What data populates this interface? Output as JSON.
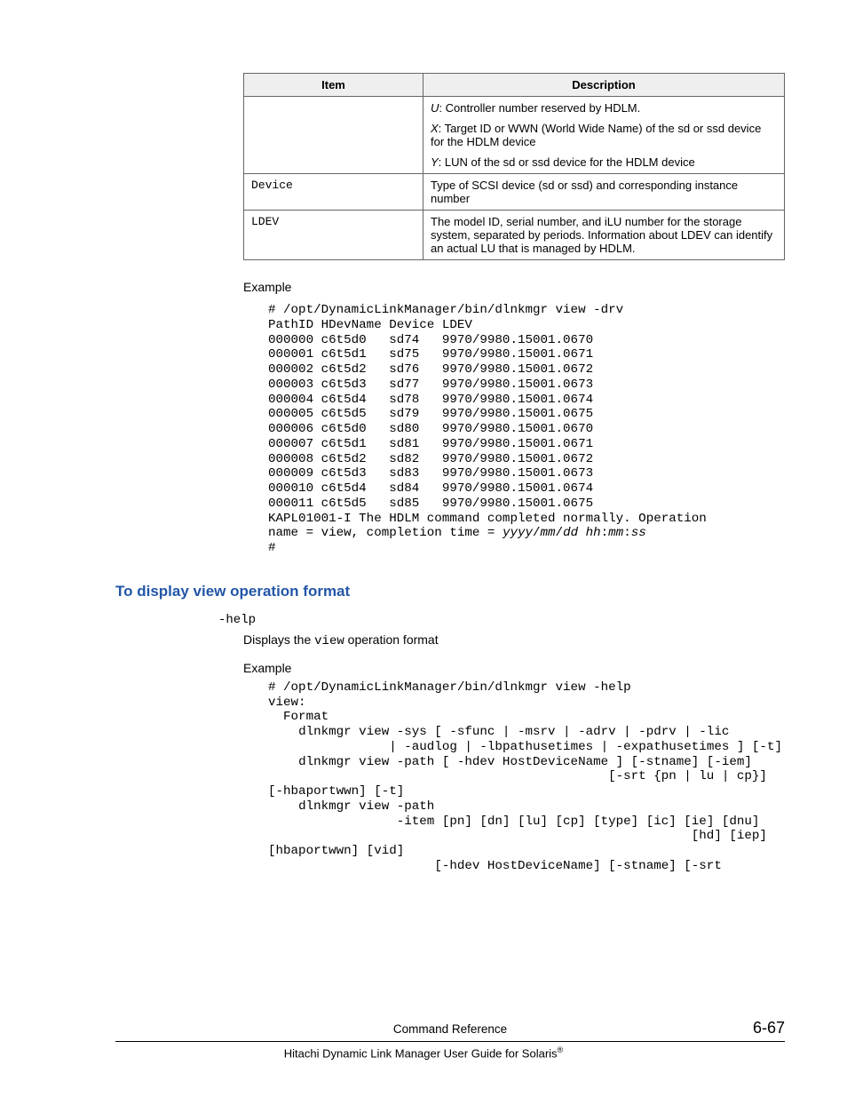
{
  "table": {
    "header": {
      "col1": "Item",
      "col2": "Description"
    },
    "rows": [
      {
        "item": "",
        "desc_parts": {
          "u": "U",
          "u_text": ": Controller number reserved by HDLM.",
          "x": "X",
          "x_text": ": Target ID or WWN (World Wide Name) of the sd or ssd device for the HDLM device",
          "y": "Y",
          "y_text": ": LUN of the sd or ssd device for the HDLM device"
        }
      },
      {
        "item": "Device",
        "desc": "Type of SCSI device (sd or ssd) and corresponding instance number"
      },
      {
        "item": "LDEV",
        "desc": "The model ID, serial number, and iLU number for the storage system, separated by periods. Information about LDEV can identify an actual LU that is managed by HDLM."
      }
    ]
  },
  "example1": {
    "label": "Example",
    "text": "# /opt/DynamicLinkManager/bin/dlnkmgr view -drv\nPathID HDevName Device LDEV\n000000 c6t5d0   sd74   9970/9980.15001.0670\n000001 c6t5d1   sd75   9970/9980.15001.0671\n000002 c6t5d2   sd76   9970/9980.15001.0672\n000003 c6t5d3   sd77   9970/9980.15001.0673\n000004 c6t5d4   sd78   9970/9980.15001.0674\n000005 c6t5d5   sd79   9970/9980.15001.0675\n000006 c6t5d0   sd80   9970/9980.15001.0670\n000007 c6t5d1   sd81   9970/9980.15001.0671\n000008 c6t5d2   sd82   9970/9980.15001.0672\n000009 c6t5d3   sd83   9970/9980.15001.0673\n000010 c6t5d4   sd84   9970/9980.15001.0674\n000011 c6t5d5   sd85   9970/9980.15001.0675\nKAPL01001-I The HDLM command completed normally. Operation ",
    "line_name": "name = view, completion time = ",
    "ts_italic": "yyyy",
    "sep1": "/",
    "mm1": "mm",
    "sep2": "/",
    "dd": "dd",
    "space": " ",
    "hh": "hh",
    "colon1": ":",
    "mm2": "mm",
    "colon2": ":",
    "ss": "ss",
    "prompt": "#"
  },
  "section": {
    "title": "To display view operation format"
  },
  "help": {
    "option": "-help",
    "desc_pre": "Displays the ",
    "desc_code": "view",
    "desc_post": " operation format",
    "example_label": "Example",
    "text": "# /opt/DynamicLinkManager/bin/dlnkmgr view -help\nview:\n  Format\n    dlnkmgr view -sys [ -sfunc | -msrv | -adrv | -pdrv | -lic \n                | -audlog | -lbpathusetimes | -expathusetimes ] [-t]\n    dlnkmgr view -path [ -hdev HostDeviceName ] [-stname] [-iem]\n                                             [-srt {pn | lu | cp}] [-hbaportwwn] [-t]\n    dlnkmgr view -path\n                 -item [pn] [dn] [lu] [cp] [type] [ic] [ie] [dnu]\n                                                        [hd] [iep] [hbaportwwn] [vid]\n                      [-hdev HostDeviceName] [-stname] [-srt "
  },
  "footer": {
    "center": "Command Reference",
    "page": "6-67",
    "title": "Hitachi Dynamic Link Manager User Guide for Solaris",
    "reg": "®"
  }
}
